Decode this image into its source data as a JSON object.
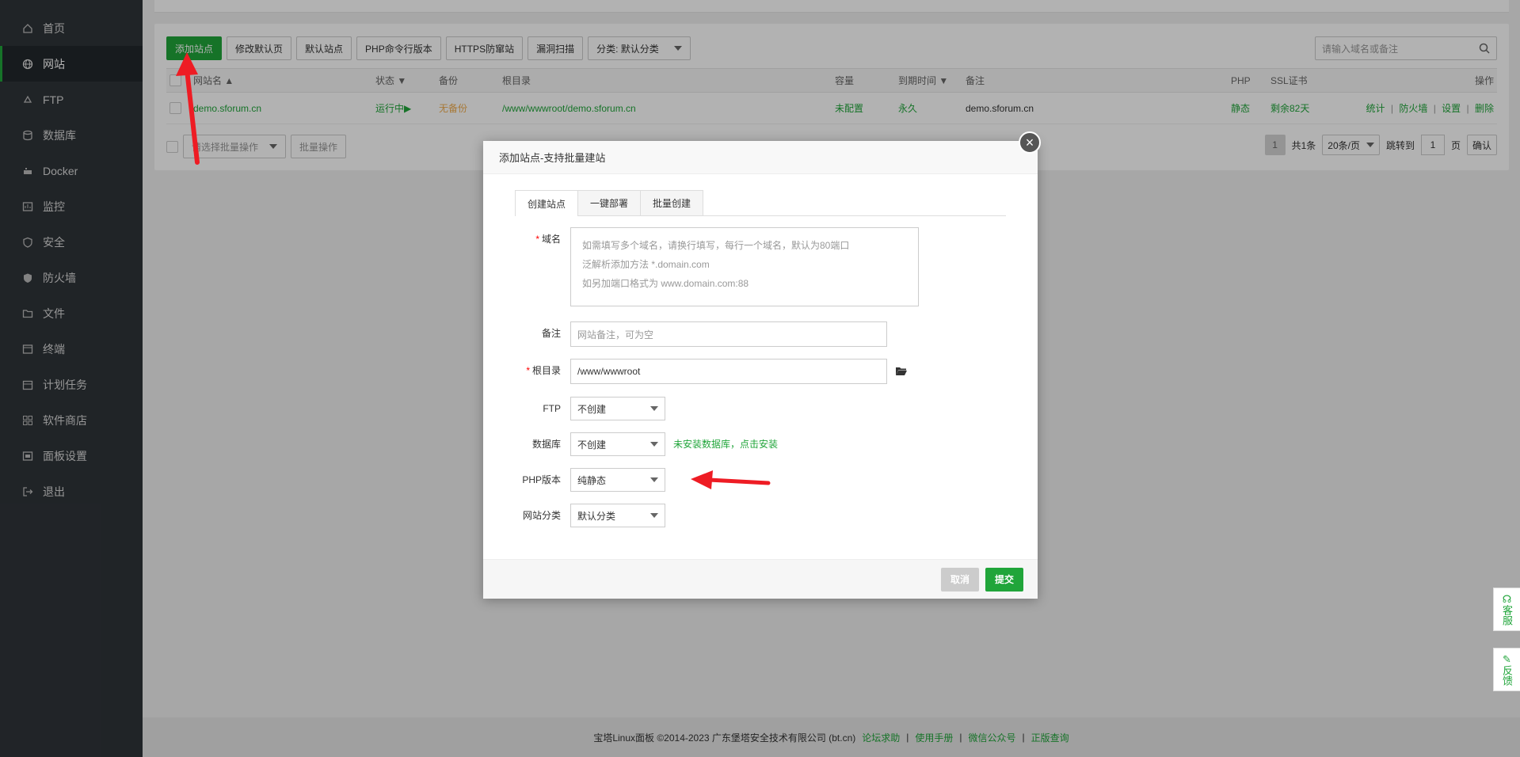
{
  "sidebar": {
    "items": [
      {
        "label": "首页",
        "icon": "home-icon"
      },
      {
        "label": "网站",
        "icon": "globe-icon",
        "active": true
      },
      {
        "label": "FTP",
        "icon": "ftp-icon"
      },
      {
        "label": "数据库",
        "icon": "database-icon"
      },
      {
        "label": "Docker",
        "icon": "docker-icon"
      },
      {
        "label": "监控",
        "icon": "monitor-icon"
      },
      {
        "label": "安全",
        "icon": "shield-icon"
      },
      {
        "label": "防火墙",
        "icon": "firewall-icon"
      },
      {
        "label": "文件",
        "icon": "folder-icon"
      },
      {
        "label": "终端",
        "icon": "terminal-icon"
      },
      {
        "label": "计划任务",
        "icon": "calendar-icon"
      },
      {
        "label": "软件商店",
        "icon": "apps-icon"
      },
      {
        "label": "面板设置",
        "icon": "panel-icon"
      },
      {
        "label": "退出",
        "icon": "logout-icon"
      }
    ]
  },
  "toolbar": {
    "add_site": "添加站点",
    "modify_default": "修改默认页",
    "default_site": "默认站点",
    "php_cli": "PHP命令行版本",
    "https_guard": "HTTPS防窜站",
    "vuln_scan": "漏洞扫描",
    "category": "分类: 默认分类"
  },
  "search": {
    "placeholder": "请输入域名或备注"
  },
  "table": {
    "headers": {
      "name": "网站名",
      "status": "状态",
      "backup": "备份",
      "root": "根目录",
      "capacity": "容量",
      "expire": "到期时间",
      "remark": "备注",
      "php": "PHP",
      "ssl": "SSL证书",
      "ops": "操作"
    },
    "rows": [
      {
        "name": "demo.sforum.cn",
        "status": "运行中▶",
        "backup": "无备份",
        "root": "/www/wwwroot/demo.sforum.cn",
        "capacity": "未配置",
        "expire": "永久",
        "remark": "demo.sforum.cn",
        "php": "静态",
        "ssl": "剩余82天",
        "ops": [
          "统计",
          "防火墙",
          "设置",
          "删除"
        ]
      }
    ]
  },
  "batch": {
    "placeholder": "请选择批量操作",
    "button": "批量操作"
  },
  "pager": {
    "current": "1",
    "total": "共1条",
    "per_page": "20条/页",
    "jump_label": "跳转到",
    "jump_value": "1",
    "page_unit": "页",
    "confirm": "确认"
  },
  "footer": {
    "copyright": "宝塔Linux面板 ©2014-2023 广东堡塔安全技术有限公司 (bt.cn)",
    "links": [
      "论坛求助",
      "使用手册",
      "微信公众号",
      "正版查询"
    ],
    "sep": "|"
  },
  "modal": {
    "title": "添加站点-支持批量建站",
    "close": "×",
    "tabs": [
      "创建站点",
      "一键部署",
      "批量创建"
    ],
    "domain_label": "域名",
    "domain_hints": [
      "如需填写多个域名，请换行填写，每行一个域名，默认为80端口",
      "泛解析添加方法 *.domain.com",
      "如另加端口格式为 www.domain.com:88"
    ],
    "remark_label": "备注",
    "remark_placeholder": "网站备注，可为空",
    "root_label": "根目录",
    "root_value": "/www/wwwroot",
    "ftp_label": "FTP",
    "ftp_value": "不创建",
    "db_label": "数据库",
    "db_value": "不创建",
    "db_hint": "未安装数据库，点击安装",
    "php_label": "PHP版本",
    "php_value": "纯静态",
    "category_label": "网站分类",
    "category_value": "默认分类",
    "cancel": "取消",
    "submit": "提交",
    "required_mark": "*"
  },
  "float": {
    "service": "客服",
    "feedback": "反馈"
  },
  "colors": {
    "accent": "#20a53a",
    "sidebar": "#2f3439",
    "arrow": "#ee1c24"
  }
}
